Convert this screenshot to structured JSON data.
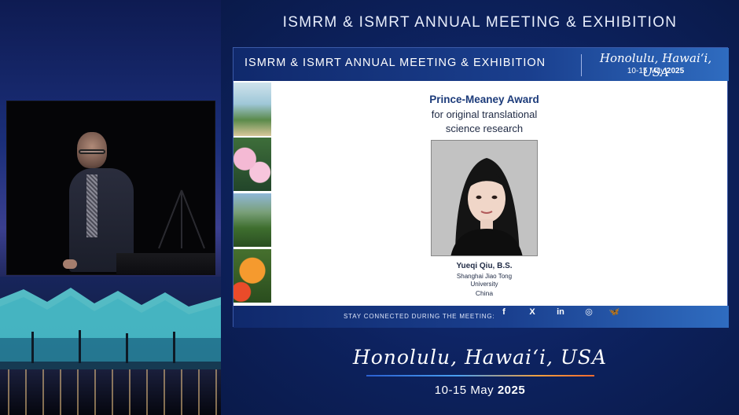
{
  "frame": {
    "title": "ISMRM & ISMRT ANNUAL MEETING & EXHIBITION",
    "location": "Honolulu, Hawai‘i, USA",
    "dates_prefix": "10-15 May",
    "dates_year": "2025"
  },
  "slide": {
    "header": {
      "title": "ISMRM & ISMRT ANNUAL MEETING & EXHIBITION",
      "location": "Honolulu, Hawai‘i, USA",
      "dates_prefix": "10-15 May",
      "dates_year": "2025"
    },
    "award": {
      "title": "Prince-Meaney Award",
      "subtitle_line1": "for original translational",
      "subtitle_line2": "science research"
    },
    "recipient": {
      "name": "Yueqi Qiu, B.S.",
      "affiliation_line1": "Shanghai Jiao Tong",
      "affiliation_line2": "University",
      "country": "China"
    },
    "footer": {
      "text": "STAY CONNECTED DURING THE MEETING:",
      "social": [
        {
          "icon": "facebook-icon",
          "glyph": "f"
        },
        {
          "icon": "x-icon",
          "glyph": "X"
        },
        {
          "icon": "linkedin-icon",
          "glyph": "in"
        },
        {
          "icon": "instagram-icon",
          "glyph": "◎"
        },
        {
          "icon": "bluesky-icon",
          "glyph": "🦋"
        }
      ]
    }
  },
  "colors": {
    "background": "#0b1a4a",
    "header_blue": "#1a3f8e",
    "award_title": "#1c3b7a"
  }
}
